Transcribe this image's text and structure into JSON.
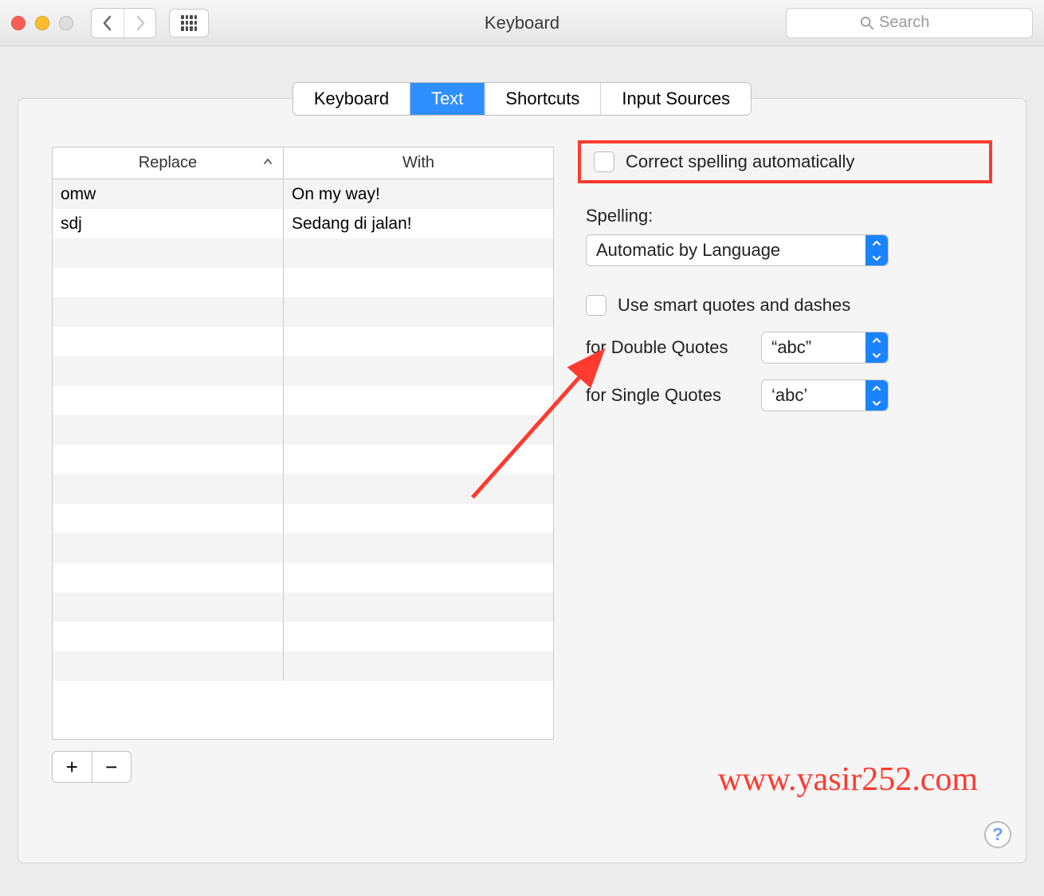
{
  "window": {
    "title": "Keyboard"
  },
  "search": {
    "placeholder": "Search"
  },
  "tabs": [
    {
      "label": "Keyboard",
      "active": false
    },
    {
      "label": "Text",
      "active": true
    },
    {
      "label": "Shortcuts",
      "active": false
    },
    {
      "label": "Input Sources",
      "active": false
    }
  ],
  "table": {
    "headers": {
      "replace": "Replace",
      "with": "With"
    },
    "rows": [
      {
        "replace": "omw",
        "with": "On my way!"
      },
      {
        "replace": "sdj",
        "with": "Sedang di jalan!"
      }
    ]
  },
  "right": {
    "correct_spelling": "Correct spelling automatically",
    "spelling_label": "Spelling:",
    "spelling_value": "Automatic by Language",
    "smart_quotes": "Use smart quotes and dashes",
    "double_quotes_label": "for Double Quotes",
    "double_quotes_value": "“abc”",
    "single_quotes_label": "for Single Quotes",
    "single_quotes_value": "‘abc’"
  },
  "annotations": {
    "watermark": "www.yasir252.com"
  },
  "buttons": {
    "plus": "+",
    "minus": "−",
    "help": "?"
  }
}
